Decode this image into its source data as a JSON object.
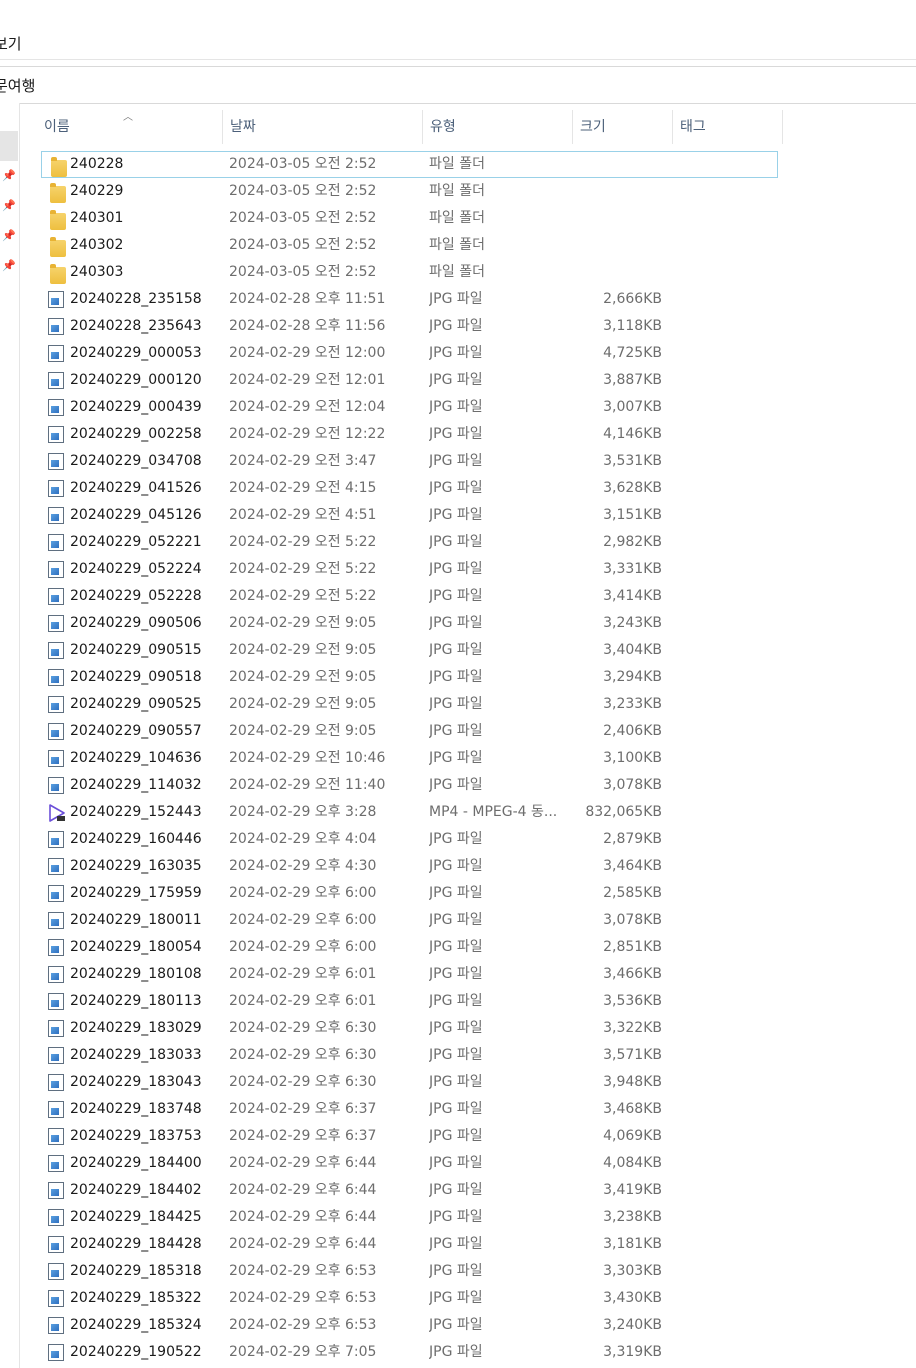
{
  "ribbon": {
    "tab_label": "보기"
  },
  "address": {
    "path_tail": "문여행"
  },
  "columns": {
    "name": "이름",
    "date": "날짜",
    "type": "유형",
    "size": "크기",
    "tags": "태그"
  },
  "files": [
    {
      "name": "240228",
      "date": "2024-03-05 오전 2:52",
      "type": "파일 폴더",
      "size": "",
      "kind": "folder"
    },
    {
      "name": "240229",
      "date": "2024-03-05 오전 2:52",
      "type": "파일 폴더",
      "size": "",
      "kind": "folder"
    },
    {
      "name": "240301",
      "date": "2024-03-05 오전 2:52",
      "type": "파일 폴더",
      "size": "",
      "kind": "folder"
    },
    {
      "name": "240302",
      "date": "2024-03-05 오전 2:52",
      "type": "파일 폴더",
      "size": "",
      "kind": "folder"
    },
    {
      "name": "240303",
      "date": "2024-03-05 오전 2:52",
      "type": "파일 폴더",
      "size": "",
      "kind": "folder"
    },
    {
      "name": "20240228_235158",
      "date": "2024-02-28 오후 11:51",
      "type": "JPG 파일",
      "size": "2,666KB",
      "kind": "jpg"
    },
    {
      "name": "20240228_235643",
      "date": "2024-02-28 오후 11:56",
      "type": "JPG 파일",
      "size": "3,118KB",
      "kind": "jpg"
    },
    {
      "name": "20240229_000053",
      "date": "2024-02-29 오전 12:00",
      "type": "JPG 파일",
      "size": "4,725KB",
      "kind": "jpg"
    },
    {
      "name": "20240229_000120",
      "date": "2024-02-29 오전 12:01",
      "type": "JPG 파일",
      "size": "3,887KB",
      "kind": "jpg"
    },
    {
      "name": "20240229_000439",
      "date": "2024-02-29 오전 12:04",
      "type": "JPG 파일",
      "size": "3,007KB",
      "kind": "jpg"
    },
    {
      "name": "20240229_002258",
      "date": "2024-02-29 오전 12:22",
      "type": "JPG 파일",
      "size": "4,146KB",
      "kind": "jpg"
    },
    {
      "name": "20240229_034708",
      "date": "2024-02-29 오전 3:47",
      "type": "JPG 파일",
      "size": "3,531KB",
      "kind": "jpg"
    },
    {
      "name": "20240229_041526",
      "date": "2024-02-29 오전 4:15",
      "type": "JPG 파일",
      "size": "3,628KB",
      "kind": "jpg"
    },
    {
      "name": "20240229_045126",
      "date": "2024-02-29 오전 4:51",
      "type": "JPG 파일",
      "size": "3,151KB",
      "kind": "jpg"
    },
    {
      "name": "20240229_052221",
      "date": "2024-02-29 오전 5:22",
      "type": "JPG 파일",
      "size": "2,982KB",
      "kind": "jpg"
    },
    {
      "name": "20240229_052224",
      "date": "2024-02-29 오전 5:22",
      "type": "JPG 파일",
      "size": "3,331KB",
      "kind": "jpg"
    },
    {
      "name": "20240229_052228",
      "date": "2024-02-29 오전 5:22",
      "type": "JPG 파일",
      "size": "3,414KB",
      "kind": "jpg"
    },
    {
      "name": "20240229_090506",
      "date": "2024-02-29 오전 9:05",
      "type": "JPG 파일",
      "size": "3,243KB",
      "kind": "jpg"
    },
    {
      "name": "20240229_090515",
      "date": "2024-02-29 오전 9:05",
      "type": "JPG 파일",
      "size": "3,404KB",
      "kind": "jpg"
    },
    {
      "name": "20240229_090518",
      "date": "2024-02-29 오전 9:05",
      "type": "JPG 파일",
      "size": "3,294KB",
      "kind": "jpg"
    },
    {
      "name": "20240229_090525",
      "date": "2024-02-29 오전 9:05",
      "type": "JPG 파일",
      "size": "3,233KB",
      "kind": "jpg"
    },
    {
      "name": "20240229_090557",
      "date": "2024-02-29 오전 9:05",
      "type": "JPG 파일",
      "size": "2,406KB",
      "kind": "jpg"
    },
    {
      "name": "20240229_104636",
      "date": "2024-02-29 오전 10:46",
      "type": "JPG 파일",
      "size": "3,100KB",
      "kind": "jpg"
    },
    {
      "name": "20240229_114032",
      "date": "2024-02-29 오전 11:40",
      "type": "JPG 파일",
      "size": "3,078KB",
      "kind": "jpg"
    },
    {
      "name": "20240229_152443",
      "date": "2024-02-29 오후 3:28",
      "type": "MP4 - MPEG-4 동...",
      "size": "832,065KB",
      "kind": "mp4"
    },
    {
      "name": "20240229_160446",
      "date": "2024-02-29 오후 4:04",
      "type": "JPG 파일",
      "size": "2,879KB",
      "kind": "jpg"
    },
    {
      "name": "20240229_163035",
      "date": "2024-02-29 오후 4:30",
      "type": "JPG 파일",
      "size": "3,464KB",
      "kind": "jpg"
    },
    {
      "name": "20240229_175959",
      "date": "2024-02-29 오후 6:00",
      "type": "JPG 파일",
      "size": "2,585KB",
      "kind": "jpg"
    },
    {
      "name": "20240229_180011",
      "date": "2024-02-29 오후 6:00",
      "type": "JPG 파일",
      "size": "3,078KB",
      "kind": "jpg"
    },
    {
      "name": "20240229_180054",
      "date": "2024-02-29 오후 6:00",
      "type": "JPG 파일",
      "size": "2,851KB",
      "kind": "jpg"
    },
    {
      "name": "20240229_180108",
      "date": "2024-02-29 오후 6:01",
      "type": "JPG 파일",
      "size": "3,466KB",
      "kind": "jpg"
    },
    {
      "name": "20240229_180113",
      "date": "2024-02-29 오후 6:01",
      "type": "JPG 파일",
      "size": "3,536KB",
      "kind": "jpg"
    },
    {
      "name": "20240229_183029",
      "date": "2024-02-29 오후 6:30",
      "type": "JPG 파일",
      "size": "3,322KB",
      "kind": "jpg"
    },
    {
      "name": "20240229_183033",
      "date": "2024-02-29 오후 6:30",
      "type": "JPG 파일",
      "size": "3,571KB",
      "kind": "jpg"
    },
    {
      "name": "20240229_183043",
      "date": "2024-02-29 오후 6:30",
      "type": "JPG 파일",
      "size": "3,948KB",
      "kind": "jpg"
    },
    {
      "name": "20240229_183748",
      "date": "2024-02-29 오후 6:37",
      "type": "JPG 파일",
      "size": "3,468KB",
      "kind": "jpg"
    },
    {
      "name": "20240229_183753",
      "date": "2024-02-29 오후 6:37",
      "type": "JPG 파일",
      "size": "4,069KB",
      "kind": "jpg"
    },
    {
      "name": "20240229_184400",
      "date": "2024-02-29 오후 6:44",
      "type": "JPG 파일",
      "size": "4,084KB",
      "kind": "jpg"
    },
    {
      "name": "20240229_184402",
      "date": "2024-02-29 오후 6:44",
      "type": "JPG 파일",
      "size": "3,419KB",
      "kind": "jpg"
    },
    {
      "name": "20240229_184425",
      "date": "2024-02-29 오후 6:44",
      "type": "JPG 파일",
      "size": "3,238KB",
      "kind": "jpg"
    },
    {
      "name": "20240229_184428",
      "date": "2024-02-29 오후 6:44",
      "type": "JPG 파일",
      "size": "3,181KB",
      "kind": "jpg"
    },
    {
      "name": "20240229_185318",
      "date": "2024-02-29 오후 6:53",
      "type": "JPG 파일",
      "size": "3,303KB",
      "kind": "jpg"
    },
    {
      "name": "20240229_185322",
      "date": "2024-02-29 오후 6:53",
      "type": "JPG 파일",
      "size": "3,430KB",
      "kind": "jpg"
    },
    {
      "name": "20240229_185324",
      "date": "2024-02-29 오후 6:53",
      "type": "JPG 파일",
      "size": "3,240KB",
      "kind": "jpg"
    },
    {
      "name": "20240229_190522",
      "date": "2024-02-29 오후 7:05",
      "type": "JPG 파일",
      "size": "3,319KB",
      "kind": "jpg"
    }
  ],
  "colors": {
    "header_text": "#4c607a",
    "focus_border": "#99d1e8",
    "secondary_text": "#6d6d6d"
  }
}
